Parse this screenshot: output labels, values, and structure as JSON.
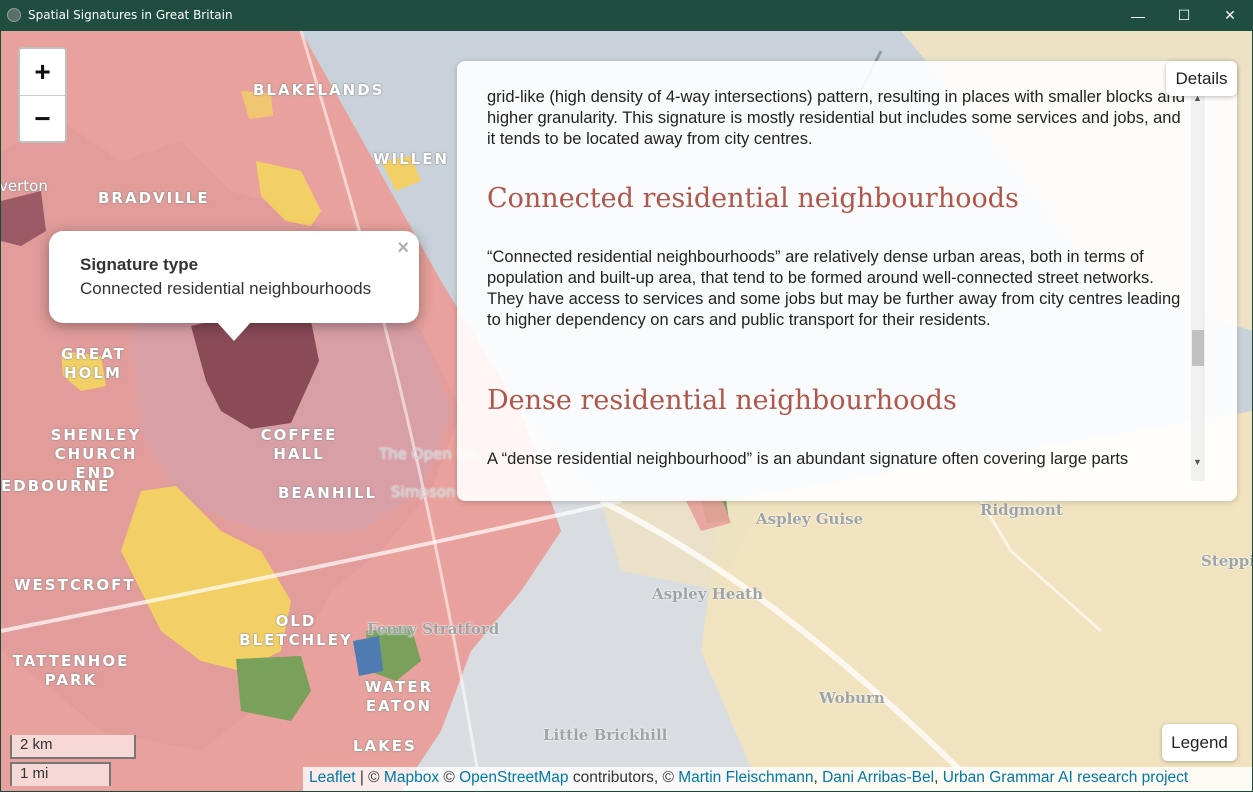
{
  "window": {
    "title": "Spatial Signatures in Great Britain",
    "minimize": "—",
    "maximize": "☐",
    "close": "✕"
  },
  "colors": {
    "residential_pink": "#e8a09b",
    "connected_dark": "#8a4a57",
    "yellow": "#f2d066",
    "green": "#79a15b",
    "blue": "#4f7bb3",
    "water_grey": "#c7d2da",
    "land": "#d9dde0",
    "rural_tan": "#f3e4be",
    "heading_red": "#b0564a"
  },
  "zoom": {
    "in_label": "+",
    "out_label": "−"
  },
  "popup": {
    "title": "Signature type",
    "value": "Connected residential neighbourhoods",
    "close": "×"
  },
  "details": {
    "button_label": "Details",
    "intro_text": "grid-like (high density of 4-way intersections) pattern, resulting in places with smaller blocks and higher granularity. This signature is mostly residential but includes some services and jobs, and it tends to be located away from city centres.",
    "section1_title": "Connected residential neighbourhoods",
    "section1_text": "“Connected residential neighbourhoods” are relatively dense urban areas, both in terms of population and built-up area, that tend to be formed around well-connected street networks. They have access to services and some jobs but may be further away from city centres leading to higher dependency on cars and public transport for their residents.",
    "section2_title": "Dense residential neighbourhoods",
    "section2_text": "A “dense residential neighbourhood” is an abundant signature often covering large parts"
  },
  "places": {
    "blakelands": "BLAKELANDS",
    "willen": "WILLEN",
    "bradville": "BRADVILLE",
    "everton": "verton",
    "great_holm": "GREAT HOLM",
    "shenley": "SHENLEY CHURCH END",
    "coffee_hall": "COFFEE HALL",
    "edbourne": "EDBOURNE",
    "beanhill": "BEANHILL",
    "westcroft": "WESTCROFT",
    "old_bletchley": "OLD BLETCHLEY",
    "tattenhoe": "TATTENHOE PARK",
    "water_eaton": "WATER EATON",
    "lakes": "LAKES",
    "fenny": "Fenny Stratford",
    "aspley_guise": "Aspley Guise",
    "aspley_heath": "Aspley Heath",
    "ridgmont": "Ridgmont",
    "woburn": "Woburn",
    "little_brickhill": "Little Brickhill",
    "simpson": "Simpson",
    "open_univ": "The Open Un",
    "steppi": "Steppi"
  },
  "legend": {
    "label": "Legend"
  },
  "scale": {
    "km": "2 km",
    "mi": "1 mi"
  },
  "attribution": {
    "leaflet": "Leaflet",
    "sep1": " | © ",
    "mapbox": "Mapbox",
    "sep2": " © ",
    "osm": "OpenStreetMap",
    "contrib": " contributors, © ",
    "martin": "Martin Fleischmann",
    "comma1": ", ",
    "dani": "Dani Arribas-Bel",
    "comma2": ", ",
    "urban": "Urban Grammar AI research project"
  }
}
